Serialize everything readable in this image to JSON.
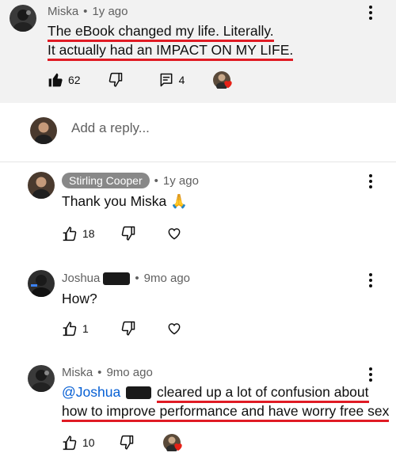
{
  "comments": [
    {
      "author": "Miska",
      "time": "1y ago",
      "lines": [
        "The eBook changed my life. Literally.",
        "It actually had an IMPACT ON MY LIFE."
      ],
      "likes": "62",
      "replies": "4"
    },
    {
      "author": "Stirling Cooper",
      "time": "1y ago",
      "text": "Thank you Miska",
      "emoji": "🙏",
      "likes": "18"
    },
    {
      "author": "Joshua",
      "time": "9mo ago",
      "text": "How?",
      "likes": "1"
    },
    {
      "author": "Miska",
      "time": "9mo ago",
      "mention": "@Joshua",
      "line1": "cleared up a lot of confusion about",
      "line2": "how to improve performance and have worry free sex",
      "likes": "10"
    }
  ],
  "reply_box": {
    "placeholder": "Add a reply..."
  },
  "separator": "•",
  "colors": {
    "highlight": "#e01b24",
    "mention": "#065fd4",
    "heart": "#e62117"
  }
}
